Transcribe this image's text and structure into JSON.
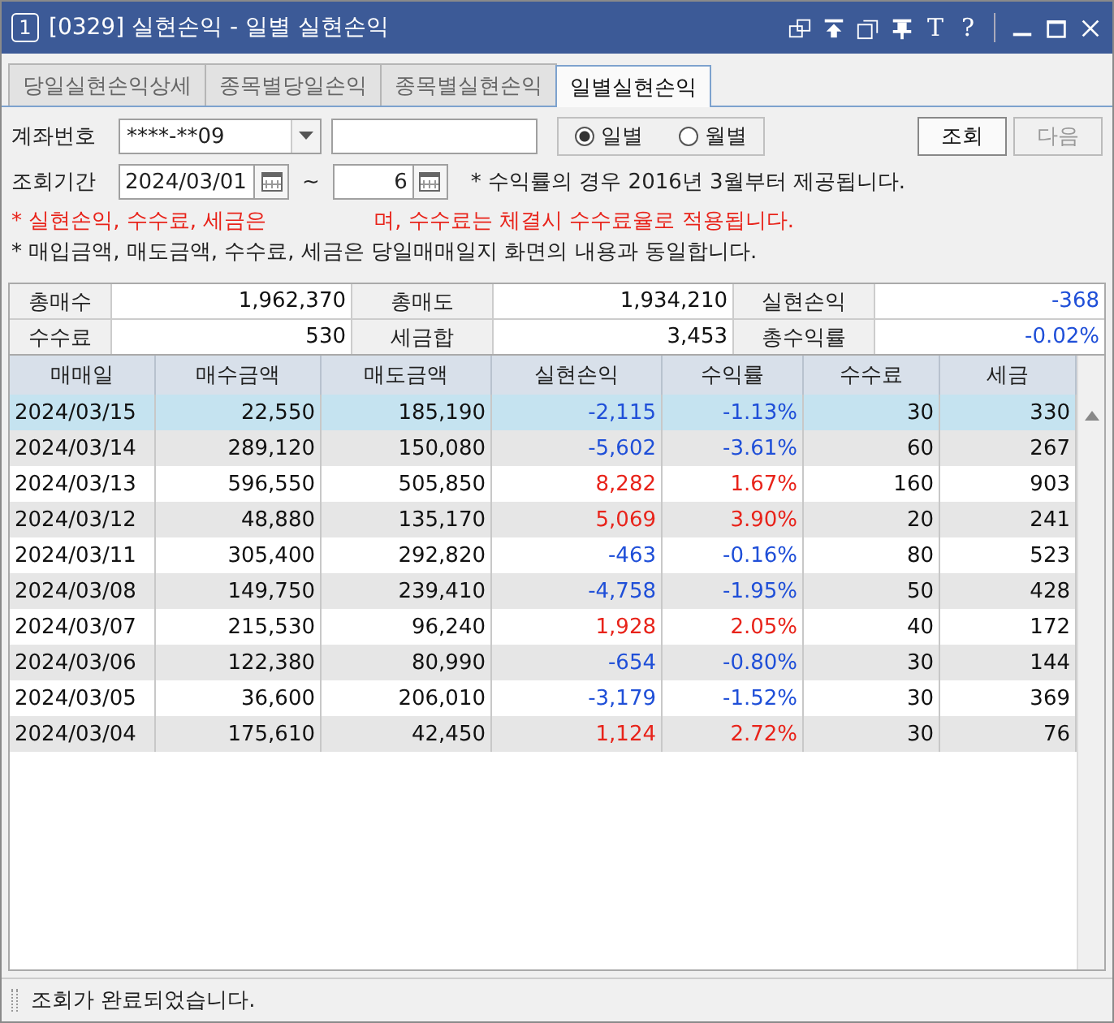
{
  "window": {
    "badge": "1",
    "title": "[0329] 실현손익 - 일별 실현손익",
    "font_button": "T",
    "help_button": "?"
  },
  "tabs": [
    {
      "label": "당일실현손익상세",
      "selected": false
    },
    {
      "label": "종목별당일손익",
      "selected": false
    },
    {
      "label": "종목별실현손익",
      "selected": false
    },
    {
      "label": "일별실현손익",
      "selected": true
    }
  ],
  "form": {
    "account_label": "계좌번호",
    "account_value": "****-**09",
    "period_label": "조회기간",
    "start_date": "2024/03/01",
    "tilde": "~",
    "end_date": "6",
    "period_options": [
      {
        "label": "일별",
        "selected": true
      },
      {
        "label": "월별",
        "selected": false
      }
    ],
    "buttons": [
      {
        "label": "조회",
        "disabled": false
      },
      {
        "label": "다음",
        "disabled": true
      }
    ],
    "period_note": "* 수익률의 경우 2016년 3월부터 제공됩니다.",
    "notes": [
      {
        "kind": "warning",
        "parts": [
          "* 실현손익, 수수료, 세금은",
          "며, 수수료는 체결시 수수료율로 적용됩니다."
        ]
      },
      {
        "kind": "info",
        "parts": [
          "* 매입금액, 매도금액, 수수료, 세금은 당일매매일지 화면의 내용과 동일합니다."
        ]
      }
    ]
  },
  "summary": [
    [
      {
        "label": "총매수",
        "value": "1,962,370",
        "color": "#111111"
      },
      {
        "label": "총매도",
        "value": "1,934,210",
        "color": "#111111"
      },
      {
        "label": "실현손익",
        "value": "-368",
        "color": "#1f4fd8"
      }
    ],
    [
      {
        "label": "수수료",
        "value": "530",
        "color": "#111111"
      },
      {
        "label": "세금합",
        "value": "3,453",
        "color": "#111111"
      },
      {
        "label": "총수익률",
        "value": "-0.02%",
        "color": "#1f4fd8"
      }
    ]
  ],
  "table": {
    "columns": [
      "매매일",
      "매수금액",
      "매도금액",
      "실현손익",
      "수익률",
      "수수료",
      "세금"
    ],
    "rows": [
      {
        "date": "2024/03/15",
        "buy": "22,550",
        "sell": "185,190",
        "pnl": "-2,115",
        "rate": "-1.13%",
        "fee": "30",
        "tax": "330",
        "color": "#1f4fd8",
        "selected": true
      },
      {
        "date": "2024/03/14",
        "buy": "289,120",
        "sell": "150,080",
        "pnl": "-5,602",
        "rate": "-3.61%",
        "fee": "60",
        "tax": "267",
        "color": "#1f4fd8",
        "selected": false
      },
      {
        "date": "2024/03/13",
        "buy": "596,550",
        "sell": "505,850",
        "pnl": "8,282",
        "rate": "1.67%",
        "fee": "160",
        "tax": "903",
        "color": "#e8231a",
        "selected": false
      },
      {
        "date": "2024/03/12",
        "buy": "48,880",
        "sell": "135,170",
        "pnl": "5,069",
        "rate": "3.90%",
        "fee": "20",
        "tax": "241",
        "color": "#e8231a",
        "selected": false
      },
      {
        "date": "2024/03/11",
        "buy": "305,400",
        "sell": "292,820",
        "pnl": "-463",
        "rate": "-0.16%",
        "fee": "80",
        "tax": "523",
        "color": "#1f4fd8",
        "selected": false
      },
      {
        "date": "2024/03/08",
        "buy": "149,750",
        "sell": "239,410",
        "pnl": "-4,758",
        "rate": "-1.95%",
        "fee": "50",
        "tax": "428",
        "color": "#1f4fd8",
        "selected": false
      },
      {
        "date": "2024/03/07",
        "buy": "215,530",
        "sell": "96,240",
        "pnl": "1,928",
        "rate": "2.05%",
        "fee": "40",
        "tax": "172",
        "color": "#e8231a",
        "selected": false
      },
      {
        "date": "2024/03/06",
        "buy": "122,380",
        "sell": "80,990",
        "pnl": "-654",
        "rate": "-0.80%",
        "fee": "30",
        "tax": "144",
        "color": "#1f4fd8",
        "selected": false
      },
      {
        "date": "2024/03/05",
        "buy": "36,600",
        "sell": "206,010",
        "pnl": "-3,179",
        "rate": "-1.52%",
        "fee": "30",
        "tax": "369",
        "color": "#1f4fd8",
        "selected": false
      },
      {
        "date": "2024/03/04",
        "buy": "175,610",
        "sell": "42,450",
        "pnl": "1,124",
        "rate": "2.72%",
        "fee": "30",
        "tax": "76",
        "color": "#e8231a",
        "selected": false
      }
    ]
  },
  "status_bar": {
    "message": "조회가 완료되었습니다."
  }
}
